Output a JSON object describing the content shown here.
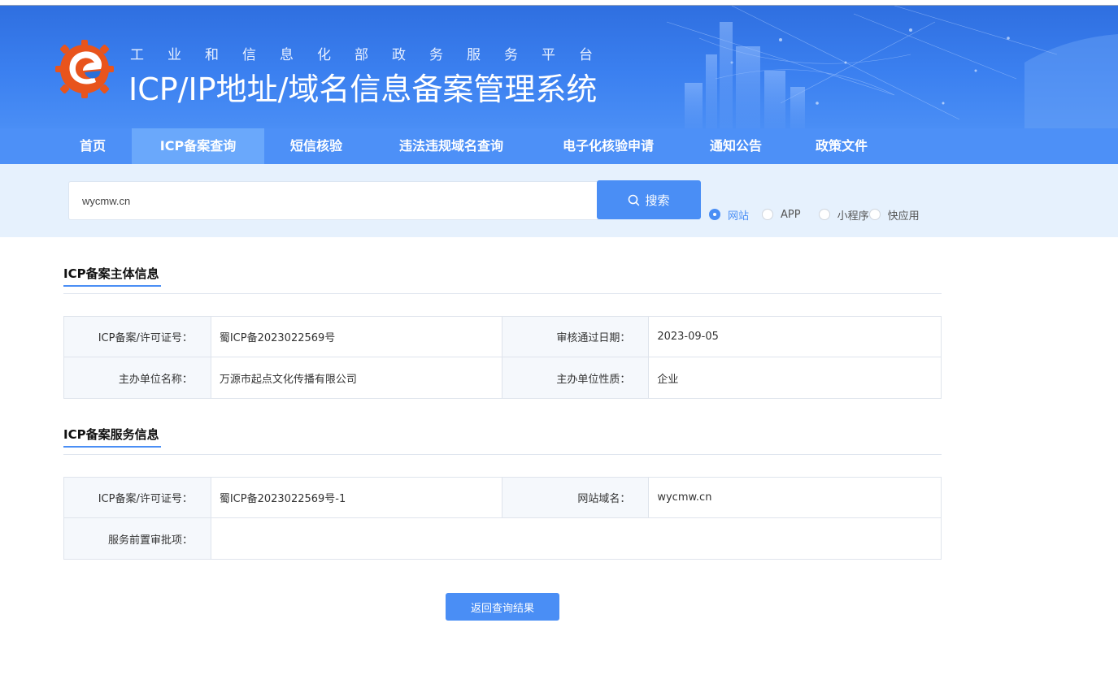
{
  "header": {
    "subtitle": "工业和信息化部政务服务平台",
    "title": "ICP/IP地址/域名信息备案管理系统"
  },
  "nav": {
    "items": [
      {
        "label": "首页",
        "active": false
      },
      {
        "label": "ICP备案查询",
        "active": true
      },
      {
        "label": "短信核验",
        "active": false
      },
      {
        "label": "违法违规域名查询",
        "active": false
      },
      {
        "label": "电子化核验申请",
        "active": false
      },
      {
        "label": "通知公告",
        "active": false
      },
      {
        "label": "政策文件",
        "active": false
      }
    ]
  },
  "search": {
    "value": "wycmw.cn",
    "button_label": "搜索",
    "types": [
      {
        "label": "网站",
        "checked": true
      },
      {
        "label": "APP",
        "checked": false
      },
      {
        "label": "小程序",
        "checked": false
      },
      {
        "label": "快应用",
        "checked": false
      }
    ]
  },
  "subject_info": {
    "title": "ICP备案主体信息",
    "license_label": "ICP备案/许可证号：",
    "license_value": "蜀ICP备2023022569号",
    "approve_date_label": "审核通过日期：",
    "approve_date_value": "2023-09-05",
    "org_name_label": "主办单位名称：",
    "org_name_value": "万源市起点文化传播有限公司",
    "org_type_label": "主办单位性质：",
    "org_type_value": "企业"
  },
  "service_info": {
    "title": "ICP备案服务信息",
    "license_label": "ICP备案/许可证号：",
    "license_value": "蜀ICP备2023022569号-1",
    "domain_label": "网站域名：",
    "domain_value": "wycmw.cn",
    "preapproval_label": "服务前置审批项：",
    "preapproval_value": ""
  },
  "back_button_label": "返回查询结果",
  "colors": {
    "primary": "#4a8ef5",
    "header_blue": "#2f6fe0",
    "search_band": "#e6f1fd"
  }
}
